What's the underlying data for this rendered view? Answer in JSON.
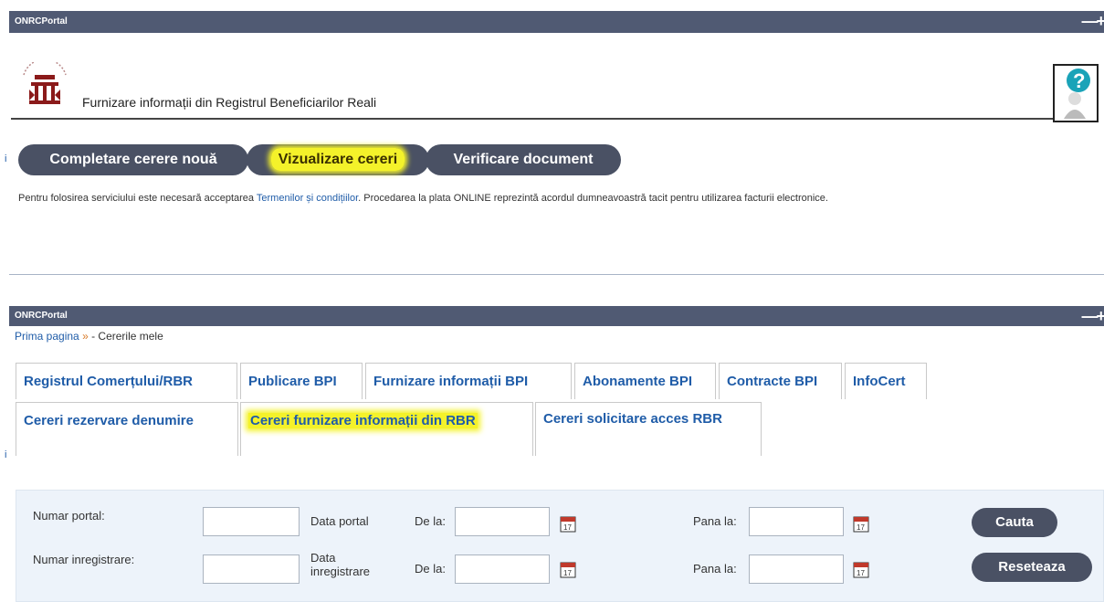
{
  "window1": {
    "title": "ONRCPortal",
    "controls": "—+"
  },
  "header": {
    "title": "Furnizare informații din Registrul Beneficiarilor Reali"
  },
  "actions": {
    "new_request": "Completare cerere nouă",
    "view_requests": "Vizualizare cereri",
    "verify_document": "Verificare document"
  },
  "notice": {
    "before": "Pentru folosirea serviciului este necesară acceptarea ",
    "link": "Termenilor și condițiilor",
    "after": ". Procedarea la plata ONLINE reprezintă acordul dumneavoastră tacit pentru utilizarea facturii electronice."
  },
  "window2": {
    "title": "ONRCPortal",
    "controls": "—+"
  },
  "breadcrumb": {
    "home": "Prima pagina",
    "separator": "»",
    "current": " - Cererile mele"
  },
  "tabs_row1": [
    "Registrul Comerțului/RBR",
    "Publicare BPI",
    "Furnizare informații BPI",
    "Abonamente BPI",
    "Contracte BPI",
    "InfoCert"
  ],
  "tabs_row2": [
    "Cereri rezervare denumire",
    "Cereri furnizare informații din RBR",
    "Cereri solicitare acces RBR"
  ],
  "filters": {
    "numar_portal": "Numar portal:",
    "data_portal": "Data portal",
    "numar_inregistrare": "Numar inregistrare:",
    "data_inregistrare": "Data inregistrare",
    "de_la": "De la:",
    "pana_la": "Pana la:",
    "cauta": "Cauta",
    "reseteaza": "Reseteaza",
    "calendar_day": "17"
  },
  "side_marks": [
    "i",
    "i"
  ],
  "colors": {
    "accent": "#4a5164",
    "highlight": "#f4f22a",
    "link": "#1f5ca8"
  }
}
